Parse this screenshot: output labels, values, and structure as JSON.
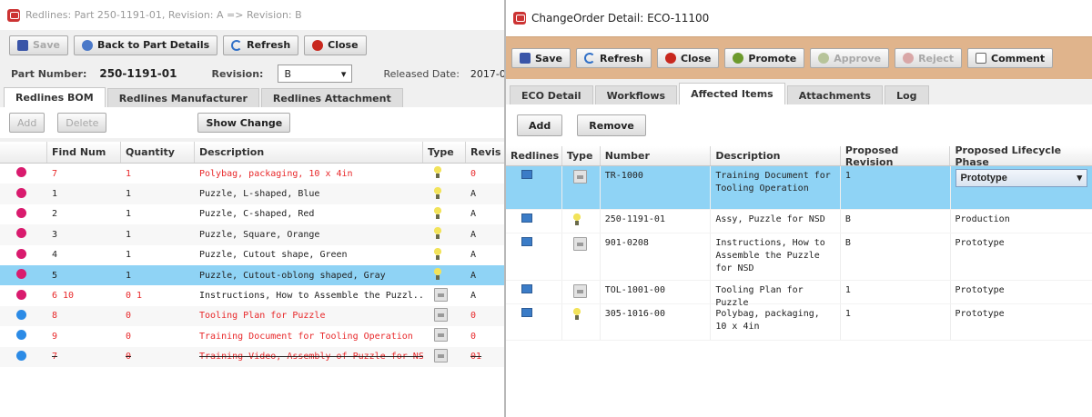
{
  "left": {
    "title": "Redlines: Part 250-1191-01, Revision: A => Revision: B",
    "toolbar": {
      "save": "Save",
      "back": "Back to Part Details",
      "refresh": "Refresh",
      "close": "Close"
    },
    "part": {
      "number_label": "Part Number:",
      "number": "250-1191-01",
      "revision_label": "Revision:",
      "revision": "B",
      "released_label": "Released Date:",
      "released": "2017-0"
    },
    "tabs": [
      "Redlines BOM",
      "Redlines Manufacturer",
      "Redlines Attachment"
    ],
    "actions": {
      "add": "Add",
      "delete": "Delete",
      "show_change": "Show Change"
    },
    "columns": [
      "Find Num",
      "Quantity",
      "Description",
      "Type",
      "Revis"
    ],
    "rows": [
      {
        "find": "7",
        "qty": "1",
        "desc": "Polybag, packaging, 10 x 4in",
        "rev": "0"
      },
      {
        "find": "1",
        "qty": "1",
        "desc": "Puzzle, L-shaped, Blue",
        "rev": "A"
      },
      {
        "find": "2",
        "qty": "1",
        "desc": "Puzzle, C-shaped, Red",
        "rev": "A"
      },
      {
        "find": "3",
        "qty": "1",
        "desc": "Puzzle, Square, Orange",
        "rev": "A"
      },
      {
        "find": "4",
        "qty": "1",
        "desc": "Puzzle, Cutout shape, Green",
        "rev": "A"
      },
      {
        "find": "5",
        "qty": "1",
        "desc": "Puzzle, Cutout-oblong shaped, Gray",
        "rev": "A"
      },
      {
        "find": "6 10",
        "qty": "0 1",
        "desc": "Instructions, How to Assemble the Puzzl...",
        "rev": "A"
      },
      {
        "find": "8",
        "qty": "0",
        "desc": "Tooling Plan for Puzzle",
        "rev": "0"
      },
      {
        "find": "9",
        "qty": "0",
        "desc": "Training Document for Tooling Operation",
        "rev": "0"
      },
      {
        "find": "7",
        "qty": "0",
        "desc": "Training Video, Assembly of Puzzle for NSD",
        "rev": "01"
      }
    ]
  },
  "right": {
    "title": "ChangeOrder Detail: ECO-11100",
    "toolbar": {
      "save": "Save",
      "refresh": "Refresh",
      "close": "Close",
      "promote": "Promote",
      "approve": "Approve",
      "reject": "Reject",
      "comment": "Comment"
    },
    "tabs": [
      "ECO Detail",
      "Workflows",
      "Affected Items",
      "Attachments",
      "Log"
    ],
    "actions": {
      "add": "Add",
      "remove": "Remove"
    },
    "columns": [
      "Redlines",
      "Type",
      "Number",
      "Description",
      "Proposed Revision",
      "Proposed Lifecycle Phase"
    ],
    "rows": [
      {
        "number": "TR-1000",
        "desc": "Training Document for Tooling Operation",
        "rev": "1",
        "phase": "Prototype"
      },
      {
        "number": "250-1191-01",
        "desc": "Assy, Puzzle for NSD",
        "rev": "B",
        "phase": "Production"
      },
      {
        "number": "901-0208",
        "desc": "Instructions, How to Assemble the Puzzle for NSD",
        "rev": "B",
        "phase": "Prototype"
      },
      {
        "number": "TOL-1001-00",
        "desc": "Tooling Plan for Puzzle",
        "rev": "1",
        "phase": "Prototype"
      },
      {
        "number": "305-1016-00",
        "desc": "Polybag, packaging, 10 x 4in",
        "rev": "1",
        "phase": "Prototype"
      }
    ]
  },
  "colors": {
    "toolbar_orange": "#e0b48c",
    "selection_blue": "#8fd3f5",
    "redline_red": "#e8282a"
  }
}
